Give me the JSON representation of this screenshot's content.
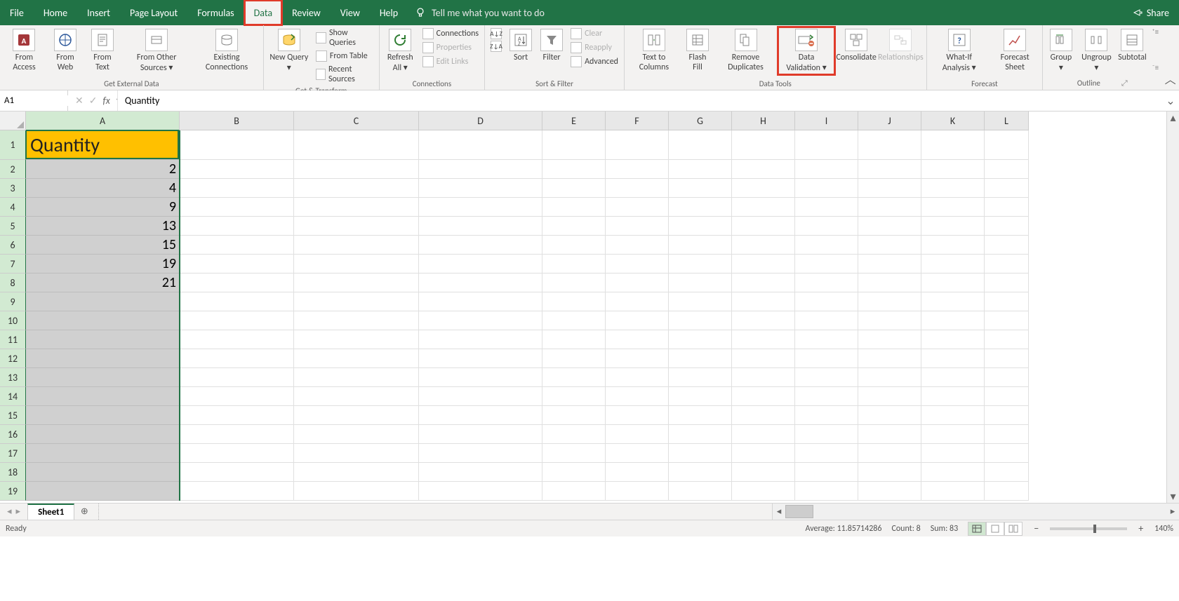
{
  "menu": {
    "items": [
      "File",
      "Home",
      "Insert",
      "Page Layout",
      "Formulas",
      "Data",
      "Review",
      "View",
      "Help"
    ],
    "active_index": 5,
    "highlighted_index": 5,
    "tell_me": "Tell me what you want to do",
    "share": "Share"
  },
  "ribbon": {
    "groups": [
      {
        "label": "Get External Data",
        "items": [
          "From Access",
          "From Web",
          "From Text",
          "From Other Sources",
          "Existing Connections"
        ]
      },
      {
        "label": "Get & Transform",
        "items": [
          "New Query",
          "Show Queries",
          "From Table",
          "Recent Sources"
        ]
      },
      {
        "label": "Connections",
        "items": [
          "Refresh All",
          "Connections",
          "Properties",
          "Edit Links"
        ]
      },
      {
        "label": "Sort & Filter",
        "items": [
          "Sort",
          "Filter",
          "Clear",
          "Reapply",
          "Advanced"
        ]
      },
      {
        "label": "Data Tools",
        "items": [
          "Text to Columns",
          "Flash Fill",
          "Remove Duplicates",
          "Data Validation",
          "Consolidate",
          "Relationships"
        ]
      },
      {
        "label": "Forecast",
        "items": [
          "What-If Analysis",
          "Forecast Sheet"
        ]
      },
      {
        "label": "Outline",
        "items": [
          "Group",
          "Ungroup",
          "Subtotal"
        ]
      }
    ],
    "highlighted_item": "Data Validation",
    "disabled_items": [
      "Properties",
      "Edit Links",
      "Clear",
      "Reapply",
      "Relationships"
    ]
  },
  "name_box": "A1",
  "formula_bar": "Quantity",
  "columns": [
    "A",
    "B",
    "C",
    "D",
    "E",
    "F",
    "G",
    "H",
    "I",
    "J",
    "K",
    "L"
  ],
  "col_widths": {
    "A": 219,
    "B": 163,
    "C": 178,
    "D": 176,
    "E": 90,
    "F": 90,
    "G": 90,
    "H": 90,
    "I": 90,
    "J": 90,
    "K": 90,
    "L": 63
  },
  "row_count": 19,
  "row_heights": {
    "1": 42
  },
  "default_row_height": 27,
  "selected_column": "A",
  "active_cell": "A1",
  "cells": {
    "A1": {
      "value": "Quantity",
      "header": true,
      "align": "left"
    },
    "A2": {
      "value": "2",
      "align": "right"
    },
    "A3": {
      "value": "4",
      "align": "right"
    },
    "A4": {
      "value": "9",
      "align": "right"
    },
    "A5": {
      "value": "13",
      "align": "right"
    },
    "A6": {
      "value": "15",
      "align": "right"
    },
    "A7": {
      "value": "19",
      "align": "right"
    },
    "A8": {
      "value": "21",
      "align": "right"
    }
  },
  "sheet_tabs": {
    "active": "Sheet1"
  },
  "status": {
    "ready": "Ready",
    "average": "Average: 11.85714286",
    "count": "Count: 8",
    "sum": "Sum: 83",
    "zoom": "140%"
  }
}
